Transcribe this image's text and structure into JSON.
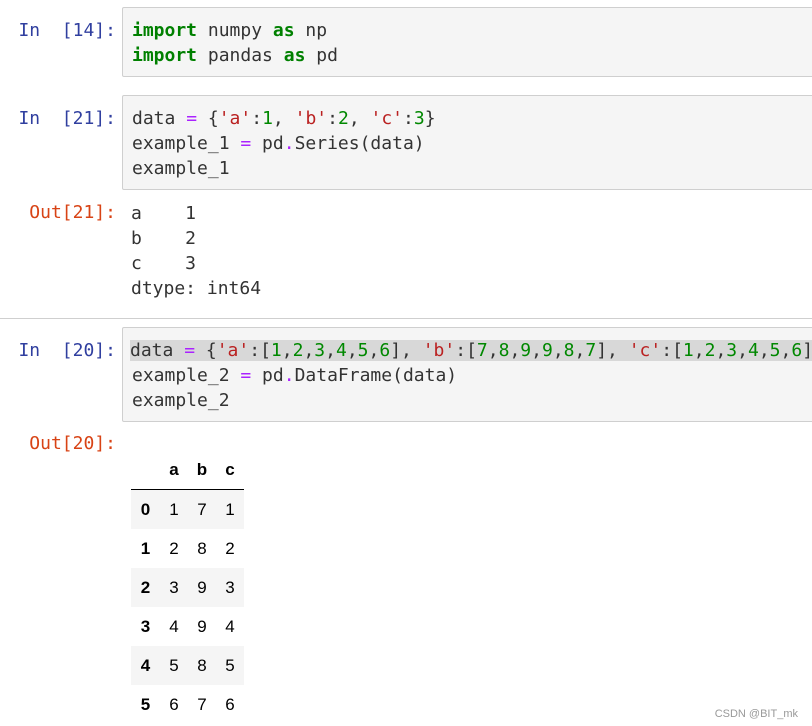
{
  "cells": [
    {
      "prompt": "In  [14]:",
      "lines": [
        [
          {
            "t": "import",
            "c": "kw"
          },
          {
            "t": " numpy ",
            "c": "plain"
          },
          {
            "t": "as",
            "c": "kw"
          },
          {
            "t": " np",
            "c": "plain"
          }
        ],
        [
          {
            "t": "import",
            "c": "kw"
          },
          {
            "t": " pandas ",
            "c": "plain"
          },
          {
            "t": "as",
            "c": "kw"
          },
          {
            "t": " pd",
            "c": "plain"
          }
        ]
      ]
    },
    {
      "prompt": "In  [21]:",
      "lines": [
        [
          {
            "t": "data ",
            "c": "plain"
          },
          {
            "t": "=",
            "c": "op"
          },
          {
            "t": " {",
            "c": "plain"
          },
          {
            "t": "'a'",
            "c": "str"
          },
          {
            "t": ":",
            "c": "plain"
          },
          {
            "t": "1",
            "c": "num"
          },
          {
            "t": ", ",
            "c": "plain"
          },
          {
            "t": "'b'",
            "c": "str"
          },
          {
            "t": ":",
            "c": "plain"
          },
          {
            "t": "2",
            "c": "num"
          },
          {
            "t": ", ",
            "c": "plain"
          },
          {
            "t": "'c'",
            "c": "str"
          },
          {
            "t": ":",
            "c": "plain"
          },
          {
            "t": "3",
            "c": "num"
          },
          {
            "t": "}",
            "c": "plain"
          }
        ],
        [
          {
            "t": "example_1 ",
            "c": "plain"
          },
          {
            "t": "=",
            "c": "op"
          },
          {
            "t": " pd",
            "c": "plain"
          },
          {
            "t": ".",
            "c": "op"
          },
          {
            "t": "Series(data)",
            "c": "plain"
          }
        ],
        [
          {
            "t": "example_1",
            "c": "plain"
          }
        ]
      ],
      "out_prompt": "Out[21]:",
      "output_lines": [
        "a    1",
        "b    2",
        "c    3",
        "dtype: int64"
      ]
    },
    {
      "prompt": "In  [20]:",
      "lines": [
        [
          {
            "t": "data ",
            "c": "plain hl"
          },
          {
            "t": "=",
            "c": "op hl"
          },
          {
            "t": " {",
            "c": "plain hl"
          },
          {
            "t": "'a'",
            "c": "str hl"
          },
          {
            "t": ":[",
            "c": "plain hl"
          },
          {
            "t": "1",
            "c": "num hl"
          },
          {
            "t": ",",
            "c": "plain hl"
          },
          {
            "t": "2",
            "c": "num hl"
          },
          {
            "t": ",",
            "c": "plain hl"
          },
          {
            "t": "3",
            "c": "num hl"
          },
          {
            "t": ",",
            "c": "plain hl"
          },
          {
            "t": "4",
            "c": "num hl"
          },
          {
            "t": ",",
            "c": "plain hl"
          },
          {
            "t": "5",
            "c": "num hl"
          },
          {
            "t": ",",
            "c": "plain hl"
          },
          {
            "t": "6",
            "c": "num hl"
          },
          {
            "t": "], ",
            "c": "plain hl"
          },
          {
            "t": "'b'",
            "c": "str hl"
          },
          {
            "t": ":[",
            "c": "plain hl"
          },
          {
            "t": "7",
            "c": "num hl"
          },
          {
            "t": ",",
            "c": "plain hl"
          },
          {
            "t": "8",
            "c": "num hl"
          },
          {
            "t": ",",
            "c": "plain hl"
          },
          {
            "t": "9",
            "c": "num hl"
          },
          {
            "t": ",",
            "c": "plain hl"
          },
          {
            "t": "9",
            "c": "num hl"
          },
          {
            "t": ",",
            "c": "plain hl"
          },
          {
            "t": "8",
            "c": "num hl"
          },
          {
            "t": ",",
            "c": "plain hl"
          },
          {
            "t": "7",
            "c": "num hl"
          },
          {
            "t": "], ",
            "c": "plain hl"
          },
          {
            "t": "'c'",
            "c": "str hl"
          },
          {
            "t": ":[",
            "c": "plain hl"
          },
          {
            "t": "1",
            "c": "num hl"
          },
          {
            "t": ",",
            "c": "plain hl"
          },
          {
            "t": "2",
            "c": "num hl"
          },
          {
            "t": ",",
            "c": "plain hl"
          },
          {
            "t": "3",
            "c": "num hl"
          },
          {
            "t": ",",
            "c": "plain hl"
          },
          {
            "t": "4",
            "c": "num hl"
          },
          {
            "t": ",",
            "c": "plain hl"
          },
          {
            "t": "5",
            "c": "num hl"
          },
          {
            "t": ",",
            "c": "plain hl"
          },
          {
            "t": "6",
            "c": "num hl"
          },
          {
            "t": "]}",
            "c": "plain hl"
          }
        ],
        [
          {
            "t": "example_2 ",
            "c": "plain"
          },
          {
            "t": "=",
            "c": "op"
          },
          {
            "t": " pd",
            "c": "plain"
          },
          {
            "t": ".",
            "c": "op"
          },
          {
            "t": "DataFrame(data)",
            "c": "plain"
          }
        ],
        [
          {
            "t": "example_2",
            "c": "plain"
          }
        ]
      ],
      "out_prompt": "Out[20]:"
    }
  ],
  "dataframe": {
    "columns": [
      "a",
      "b",
      "c"
    ],
    "rows": [
      {
        "index": "0",
        "values": [
          "1",
          "7",
          "1"
        ]
      },
      {
        "index": "1",
        "values": [
          "2",
          "8",
          "2"
        ]
      },
      {
        "index": "2",
        "values": [
          "3",
          "9",
          "3"
        ]
      },
      {
        "index": "3",
        "values": [
          "4",
          "9",
          "4"
        ]
      },
      {
        "index": "4",
        "values": [
          "5",
          "8",
          "5"
        ]
      },
      {
        "index": "5",
        "values": [
          "6",
          "7",
          "6"
        ]
      }
    ]
  },
  "watermark": "CSDN @BIT_mk"
}
